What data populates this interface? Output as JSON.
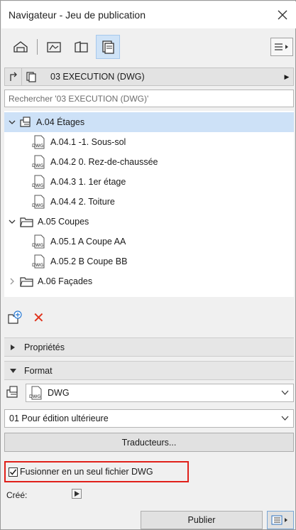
{
  "window": {
    "title": "Navigateur - Jeu de publication"
  },
  "path": {
    "label": "03 EXECUTION (DWG)"
  },
  "search": {
    "placeholder": "Rechercher '03 EXECUTION (DWG)'"
  },
  "tree": {
    "folder1": {
      "label": "A.04 Étages"
    },
    "i1": {
      "label": "A.04.1 -1. Sous-sol"
    },
    "i2": {
      "label": "A.04.2 0. Rez-de-chaussée"
    },
    "i3": {
      "label": "A.04.3 1. 1er étage"
    },
    "i4": {
      "label": "A.04.4 2. Toiture"
    },
    "folder2": {
      "label": "A.05 Coupes"
    },
    "i5": {
      "label": "A.05.1 A Coupe AA"
    },
    "i6": {
      "label": "A.05.2 B Coupe BB"
    },
    "folder3": {
      "label": "A.06 Façades"
    }
  },
  "sections": {
    "properties": "Propriétés",
    "format": "Format"
  },
  "format": {
    "type": "DWG",
    "preset": "01 Pour édition ultérieure",
    "translators": "Traducteurs..."
  },
  "merge": {
    "label": "Fusionner en un seul fichier DWG",
    "checked": true
  },
  "created": {
    "label": "Créé:"
  },
  "footer": {
    "publish": "Publier"
  },
  "colors": {
    "selection": "#cde1f7",
    "highlight_border": "#e0201a",
    "delete": "#e0331c"
  }
}
